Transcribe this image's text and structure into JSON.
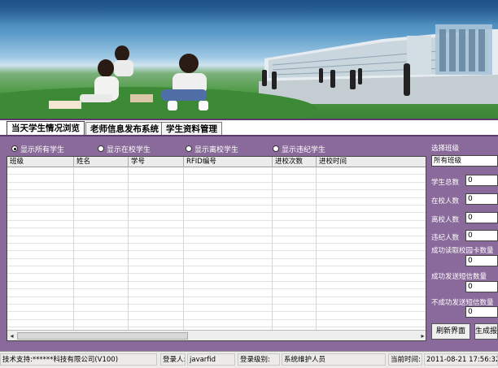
{
  "banner": {
    "alt": ""
  },
  "tabs": [
    {
      "label": "当天学生情况浏览",
      "active": true
    },
    {
      "label": "老师信息发布系统",
      "active": false
    },
    {
      "label": "学生资料管理",
      "active": false
    }
  ],
  "filters": [
    {
      "label": "显示所有学生",
      "checked": true
    },
    {
      "label": "显示在校学生",
      "checked": false
    },
    {
      "label": "显示离校学生",
      "checked": false
    },
    {
      "label": "显示违纪学生",
      "checked": false
    }
  ],
  "grid": {
    "columns": [
      "班级",
      "姓名",
      "学号",
      "RFID编号",
      "进校次数",
      "进校时间"
    ],
    "rows": []
  },
  "side": {
    "class_label": "选择班级",
    "class_value": "所有班级",
    "total_label": "学生总数",
    "total_value": "0",
    "in_label": "在校人数",
    "in_value": "0",
    "out_label": "离校人数",
    "out_value": "0",
    "violation_label": "违纪人数",
    "violation_value": "0",
    "read_ok_label": "成功读取校园卡数量",
    "read_ok_value": "0",
    "sms_ok_label": "成功发送短信数量",
    "sms_ok_value": "0",
    "sms_fail_label": "不成功发送短信数量",
    "sms_fail_value": "0",
    "refresh_label": "刷新界面",
    "generate_label": "生成报"
  },
  "status": {
    "support": "技术支持:******科技有限公司(V100)",
    "user_label": "登录人:",
    "user_value": "javarfid",
    "level_label": "登录级别:",
    "level_value": "系统维护人员",
    "time_label": "当前时间:",
    "time_value": "2011-08-21 17:56:32"
  },
  "colors": {
    "panel": "#8a6a9a",
    "frame": "#5a3a6a"
  }
}
